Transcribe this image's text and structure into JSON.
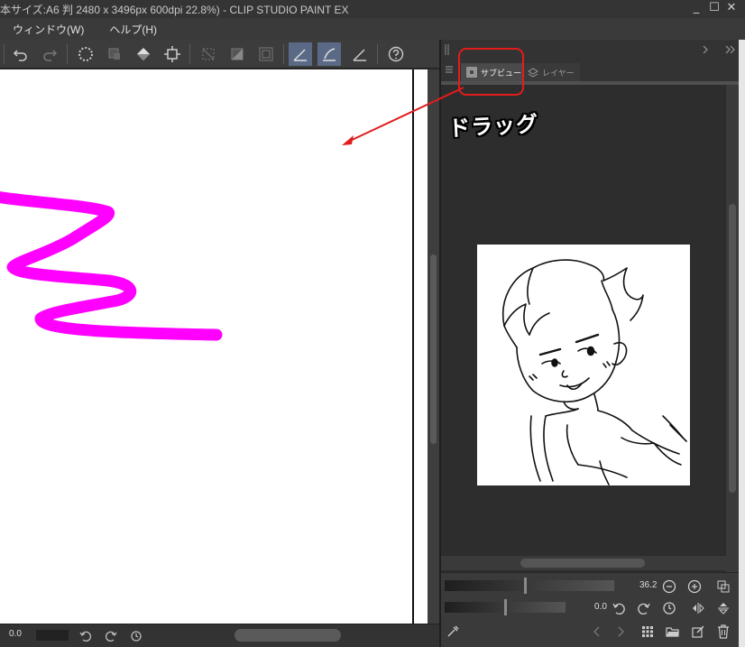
{
  "window": {
    "title": "本サイズ:A6 判 2480 x 3496px 600dpi 22.8%) - CLIP STUDIO PAINT EX",
    "minimize": "_",
    "maximize": "☐",
    "close": "✕"
  },
  "menu": {
    "items": [
      {
        "label": "ウィンドウ(W)"
      },
      {
        "label": "ヘルプ(H)"
      }
    ]
  },
  "toolbar": {
    "icons": [
      "undo-icon",
      "redo-icon",
      "clear-icon",
      "fill-outside-icon",
      "fill-icon",
      "crop-icon",
      "selection-clear-icon",
      "selection-invert-icon",
      "selection-expand-icon",
      "ruler-snap-icon",
      "special-ruler-snap-icon",
      "grid-snap-icon",
      "help-icon"
    ]
  },
  "canvas": {
    "stroke_color": "#ff00ff"
  },
  "status": {
    "zoom_value": "0.0"
  },
  "panel": {
    "tabs": [
      {
        "label": "サブビュー",
        "icon": "subview-icon",
        "active": true
      },
      {
        "label": "レイヤー",
        "icon": "layer-icon",
        "active": false
      }
    ],
    "controls": {
      "zoom_value": "36.2",
      "rotate_value": "0.0"
    }
  },
  "annotation": {
    "label": "ドラッグ",
    "color": "#e21c1c"
  }
}
